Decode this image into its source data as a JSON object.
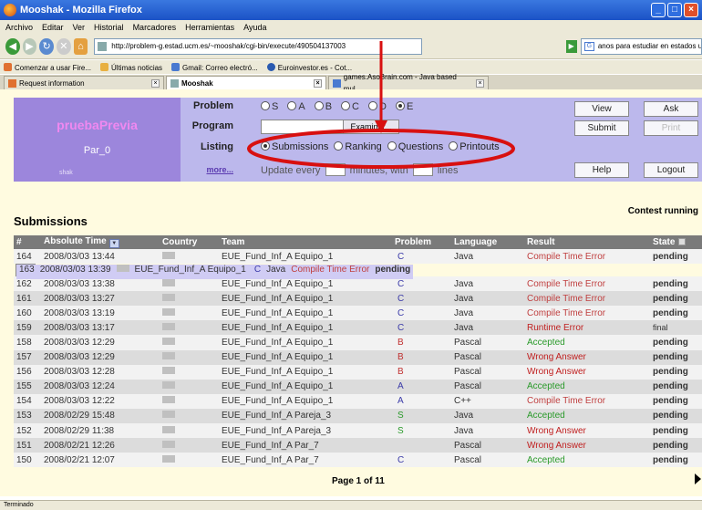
{
  "window": {
    "title": "Mooshak - Mozilla Firefox"
  },
  "menu": [
    "Archivo",
    "Editar",
    "Ver",
    "Historial",
    "Marcadores",
    "Herramientas",
    "Ayuda"
  ],
  "nav": {
    "url": "http://problem-g.estad.ucm.es/~mooshak/cgi-bin/execute/490504137003",
    "search_value": "anos para estudiar en estados unidos"
  },
  "bookmarks": [
    "Comenzar a usar Fire...",
    "Últimas noticias",
    "Gmail: Correo electró...",
    "Euroinvestor.es - Cot..."
  ],
  "tabs": [
    {
      "label": "Request information"
    },
    {
      "label": "Mooshak"
    },
    {
      "label": "games.AsoBrain.com - Java based mul..."
    }
  ],
  "contest": {
    "name": "pruebaPrevia",
    "team": "Par_0",
    "logo": "shak"
  },
  "panel": {
    "problem_label": "Problem",
    "problem_options": [
      "S",
      "A",
      "B",
      "C",
      "D",
      "E"
    ],
    "problem_selected": "E",
    "program_label": "Program",
    "browse_label": "Examinar...",
    "listing_label": "Listing",
    "listing_options": [
      "Submissions",
      "Ranking",
      "Questions",
      "Printouts"
    ],
    "listing_selected": "Submissions",
    "more_label": "more...",
    "update_text_1": "Update every",
    "update_text_2": "minutes, with",
    "update_text_3": "lines",
    "buttons": {
      "view": "View",
      "ask": "Ask",
      "submit": "Submit",
      "print": "Print",
      "help": "Help",
      "logout": "Logout"
    }
  },
  "contest_status": "Contest running",
  "heading": "Submissions",
  "table": {
    "columns": [
      "#",
      "Absolute Time",
      "Country",
      "Team",
      "Problem",
      "Language",
      "Result",
      "State"
    ],
    "rows": [
      {
        "num": "164",
        "time": "2008/03/03 13:44",
        "team": "EUE_Fund_Inf_A Equipo_1",
        "problem": "C",
        "language": "Java",
        "result": "Compile Time Error",
        "state": "pending"
      },
      {
        "num": "163",
        "time": "2008/03/03 13:39",
        "team": "EUE_Fund_Inf_A Equipo_1",
        "problem": "C",
        "language": "Java",
        "result": "Compile Time Error",
        "state": "pending"
      },
      {
        "num": "162",
        "time": "2008/03/03 13:38",
        "team": "EUE_Fund_Inf_A Equipo_1",
        "problem": "C",
        "language": "Java",
        "result": "Compile Time Error",
        "state": "pending"
      },
      {
        "num": "161",
        "time": "2008/03/03 13:27",
        "team": "EUE_Fund_Inf_A Equipo_1",
        "problem": "C",
        "language": "Java",
        "result": "Compile Time Error",
        "state": "pending"
      },
      {
        "num": "160",
        "time": "2008/03/03 13:19",
        "team": "EUE_Fund_Inf_A Equipo_1",
        "problem": "C",
        "language": "Java",
        "result": "Compile Time Error",
        "state": "pending"
      },
      {
        "num": "159",
        "time": "2008/03/03 13:17",
        "team": "EUE_Fund_Inf_A Equipo_1",
        "problem": "C",
        "language": "Java",
        "result": "Runtime Error",
        "state": "final"
      },
      {
        "num": "158",
        "time": "2008/03/03 12:29",
        "team": "EUE_Fund_Inf_A Equipo_1",
        "problem": "B",
        "language": "Pascal",
        "result": "Accepted",
        "state": "pending"
      },
      {
        "num": "157",
        "time": "2008/03/03 12:29",
        "team": "EUE_Fund_Inf_A Equipo_1",
        "problem": "B",
        "language": "Pascal",
        "result": "Wrong Answer",
        "state": "pending"
      },
      {
        "num": "156",
        "time": "2008/03/03 12:28",
        "team": "EUE_Fund_Inf_A Equipo_1",
        "problem": "B",
        "language": "Pascal",
        "result": "Wrong Answer",
        "state": "pending"
      },
      {
        "num": "155",
        "time": "2008/03/03 12:24",
        "team": "EUE_Fund_Inf_A Equipo_1",
        "problem": "A",
        "language": "Pascal",
        "result": "Accepted",
        "state": "pending"
      },
      {
        "num": "154",
        "time": "2008/03/03 12:22",
        "team": "EUE_Fund_Inf_A Equipo_1",
        "problem": "A",
        "language": "C++",
        "result": "Compile Time Error",
        "state": "pending"
      },
      {
        "num": "153",
        "time": "2008/02/29 15:48",
        "team": "EUE_Fund_Inf_A Pareja_3",
        "problem": "S",
        "language": "Java",
        "result": "Accepted",
        "state": "pending"
      },
      {
        "num": "152",
        "time": "2008/02/29 11:38",
        "team": "EUE_Fund_Inf_A Pareja_3",
        "problem": "S",
        "language": "Java",
        "result": "Wrong Answer",
        "state": "pending"
      },
      {
        "num": "151",
        "time": "2008/02/21 12:26",
        "team": "EUE_Fund_Inf_A Par_7",
        "problem": "",
        "language": "Pascal",
        "result": "Wrong Answer",
        "state": "pending"
      },
      {
        "num": "150",
        "time": "2008/02/21 12:07",
        "team": "EUE_Fund_Inf_A Par_7",
        "problem": "C",
        "language": "Pascal",
        "result": "Accepted",
        "state": "pending"
      }
    ],
    "selected_row": "163"
  },
  "pager": "Page 1 of 11",
  "statusbar": "Terminado",
  "colors": {
    "problem": {
      "A": "#3a3aa8",
      "B": "#c03030",
      "C": "#3a3aa8",
      "S": "#2a9a2a"
    },
    "result": {
      "Compile Time Error": "#c04040",
      "Runtime Error": "#c02020",
      "Accepted": "#2a9a2a",
      "Wrong Answer": "#c02020"
    },
    "annotation": "#d81010"
  }
}
